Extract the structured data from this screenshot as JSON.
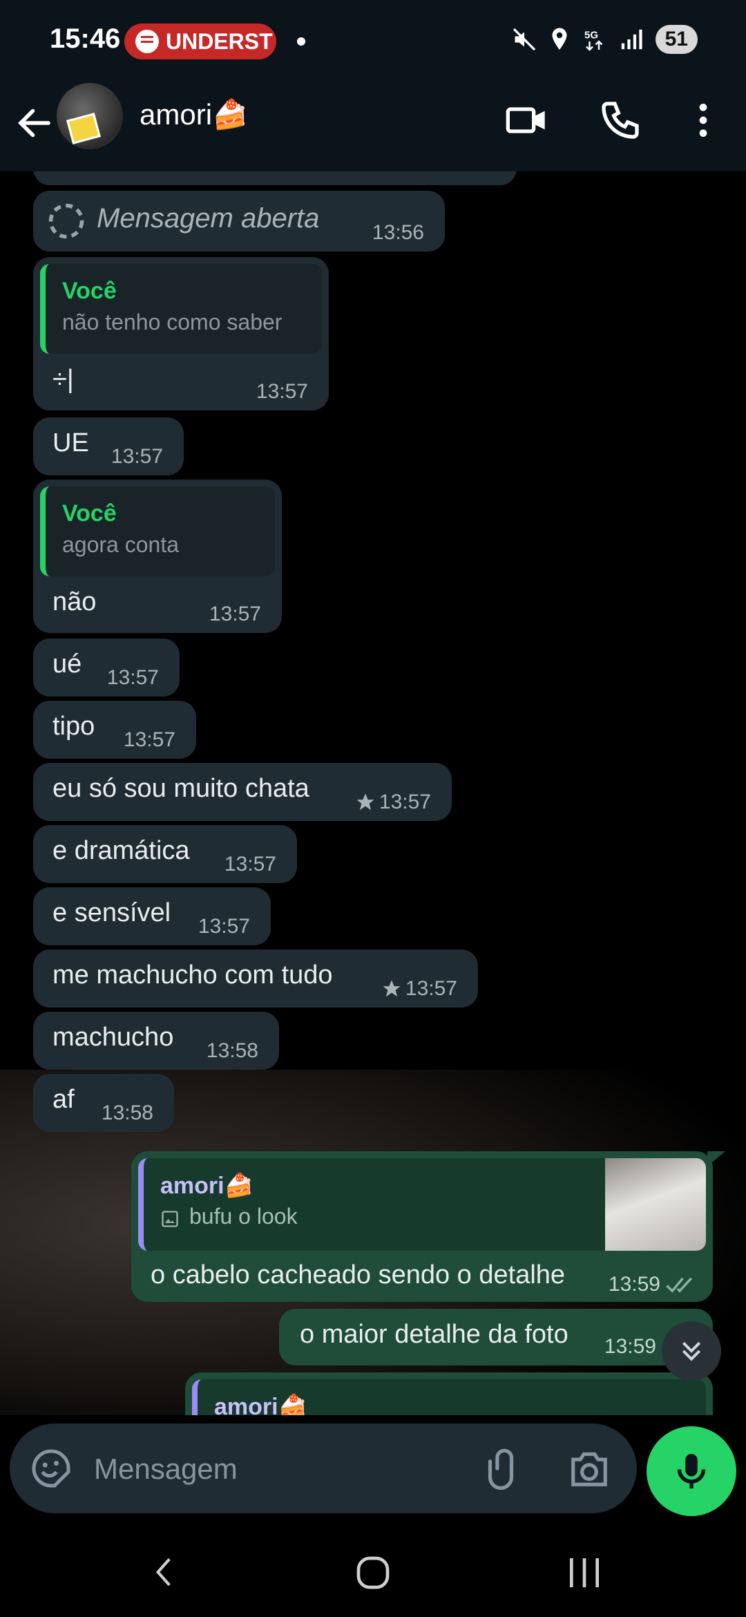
{
  "status_bar": {
    "time": "15:46",
    "now_playing_pill": "UNDERST",
    "battery": "51"
  },
  "header": {
    "contact_name": "amori🍰"
  },
  "messages": [
    {
      "text": "Mensagem aberta",
      "time": "13:56"
    },
    {
      "quote_author": "Você",
      "quote_text": "não tenho como saber",
      "text": "÷|",
      "time": "13:57"
    },
    {
      "text": "UE",
      "time": "13:57"
    },
    {
      "quote_author": "Você",
      "quote_text": "agora conta",
      "text": "não",
      "time": "13:57"
    },
    {
      "text": "ué",
      "time": "13:57"
    },
    {
      "text": "tipo",
      "time": "13:57"
    },
    {
      "text": "eu só sou muito chata",
      "time": "13:57",
      "starred": true
    },
    {
      "text": "e dramática",
      "time": "13:57"
    },
    {
      "text": "e sensível",
      "time": "13:57"
    },
    {
      "text": "me machucho com tudo",
      "time": "13:57",
      "starred": true
    },
    {
      "text": "machucho",
      "time": "13:58"
    },
    {
      "text": "af",
      "time": "13:58"
    },
    {
      "quote_author": "amori🍰",
      "quote_text": "bufu o look",
      "text": "o cabelo cacheado sendo o detalhe",
      "time": "13:59",
      "outgoing": true
    },
    {
      "text": "o maior detalhe da foto",
      "time": "13:59",
      "outgoing": true
    },
    {
      "quote_author": "amori🍰",
      "outgoing": true
    }
  ],
  "composer": {
    "placeholder": "Mensagem"
  },
  "colors": {
    "accent": "#25d366",
    "incoming_bubble": "#202c33",
    "outgoing_bubble": "#1f4d3a",
    "quote_bar_other": "#9b8cf5"
  }
}
